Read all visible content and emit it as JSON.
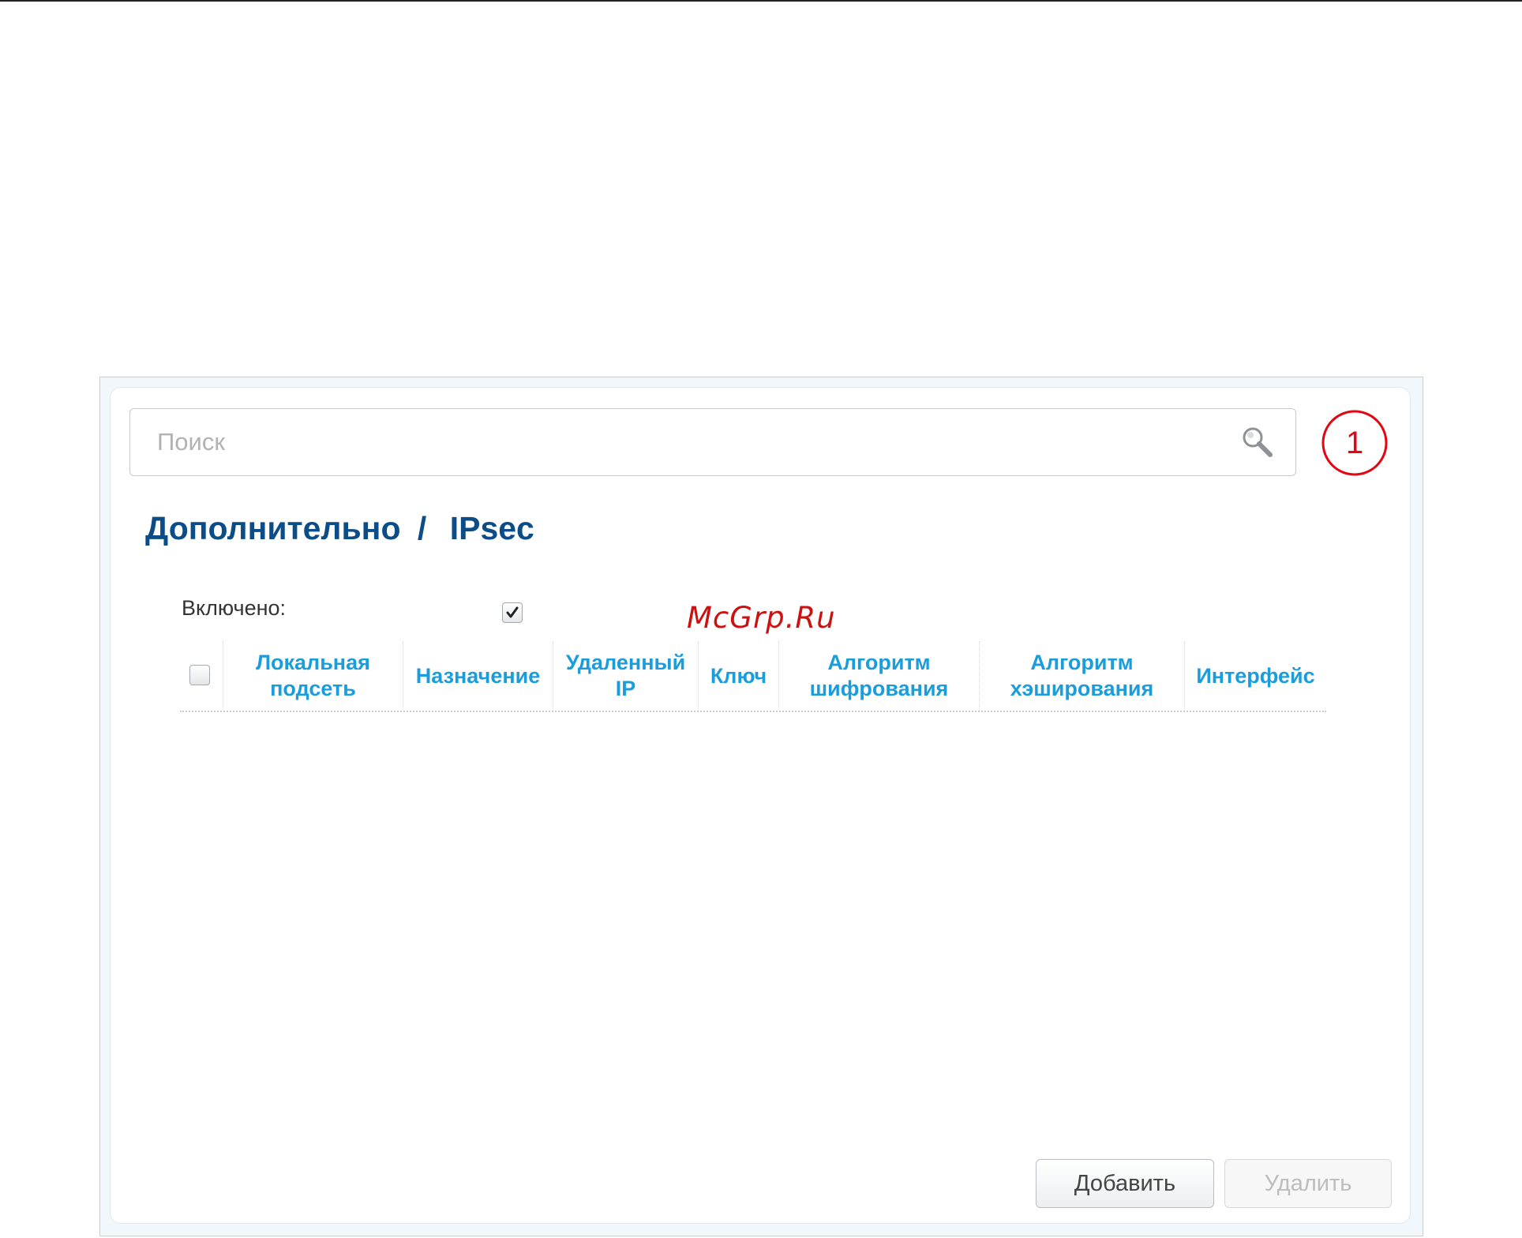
{
  "search": {
    "placeholder": "Поиск",
    "value": ""
  },
  "callout": {
    "number": "1",
    "color": "#e30613"
  },
  "breadcrumb": {
    "section": "Дополнительно",
    "separator": "/",
    "page": "IPsec"
  },
  "form": {
    "enabled_label": "Включено:",
    "enabled_checked": true
  },
  "table": {
    "select_all_checked": false,
    "columns": [
      [
        "Локальная",
        "подсеть"
      ],
      [
        "Назначение"
      ],
      [
        "Удаленный",
        "IP"
      ],
      [
        "Ключ"
      ],
      [
        "Алгоритм",
        "шифрования"
      ],
      [
        "Алгоритм",
        "хэширования"
      ],
      [
        "Интерфейс"
      ]
    ],
    "rows": []
  },
  "actions": {
    "add_label": "Добавить",
    "delete_label": "Удалить",
    "delete_disabled": true
  },
  "watermark": "McGrp.Ru",
  "colors": {
    "title": "#0d4d87",
    "column_header": "#1b9ddb",
    "callout": "#e30613"
  },
  "icons": {
    "search": "search-icon",
    "checkbox_checked": "checkmark-icon"
  }
}
